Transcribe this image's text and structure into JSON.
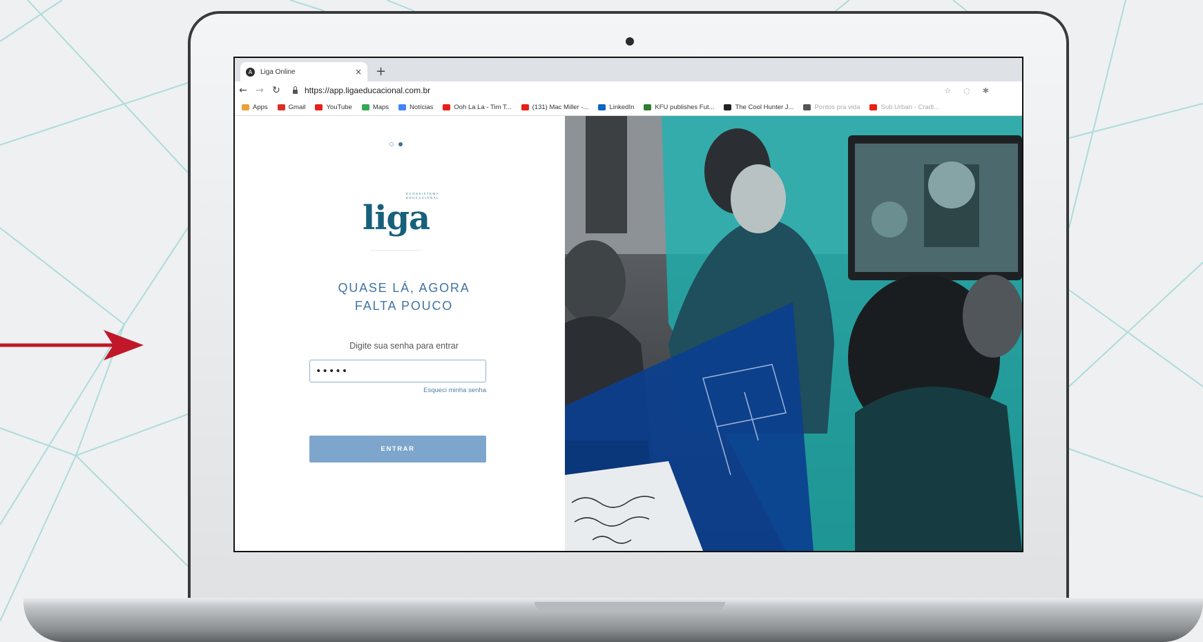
{
  "browser": {
    "tab_title": "Liga Online",
    "tab_favicon": "A",
    "new_tab": "+",
    "close_tab": "×",
    "url": "https://app.ligaeducacional.com.br",
    "bookmarks": [
      {
        "label": "Apps",
        "icon": "apps-grid-icon",
        "color": "#e8a23b"
      },
      {
        "label": "Gmail",
        "icon": "gmail-icon",
        "color": "#d93025"
      },
      {
        "label": "YouTube",
        "icon": "youtube-icon",
        "color": "#e62117"
      },
      {
        "label": "Maps",
        "icon": "maps-icon",
        "color": "#34a853"
      },
      {
        "label": "Notícias",
        "icon": "news-icon",
        "color": "#4285f4"
      },
      {
        "label": "Ooh La La - Tim T...",
        "icon": "youtube-icon",
        "color": "#e62117"
      },
      {
        "label": "(131) Mac Miller -...",
        "icon": "youtube-icon",
        "color": "#e62117"
      },
      {
        "label": "LinkedIn",
        "icon": "linkedin-icon",
        "color": "#0a66c2"
      },
      {
        "label": "KFU publishes Fut...",
        "icon": "kfu-icon",
        "color": "#2f7d32"
      },
      {
        "label": "The Cool Hunter J...",
        "icon": "c-icon",
        "color": "#222222"
      },
      {
        "label": "Pontos pra vida",
        "icon": "globe-icon",
        "color": "#555555"
      },
      {
        "label": "Sub Urban - Cradl...",
        "icon": "youtube-icon",
        "color": "#e62117"
      }
    ]
  },
  "login": {
    "logo_word": "liga",
    "logo_tag_line1": "ECOSSISTEMA",
    "logo_tag_line2": "EDUCACIONAL",
    "heading_line1": "QUASE LÁ, AGORA",
    "heading_line2": "FALTA POUCO",
    "prompt": "Digite sua senha para entrar",
    "password_value": "•••••",
    "forgot_password": "Esqueci minha senha",
    "submit_label": "ENTRAR",
    "carousel_step": 2,
    "carousel_total": 2
  },
  "colors": {
    "brand_blue": "#3f73a3",
    "button_blue": "#7ea6cc",
    "teal": "#1bb3b1",
    "navy": "#0c3f8f",
    "arrow_red": "#c0182a"
  }
}
